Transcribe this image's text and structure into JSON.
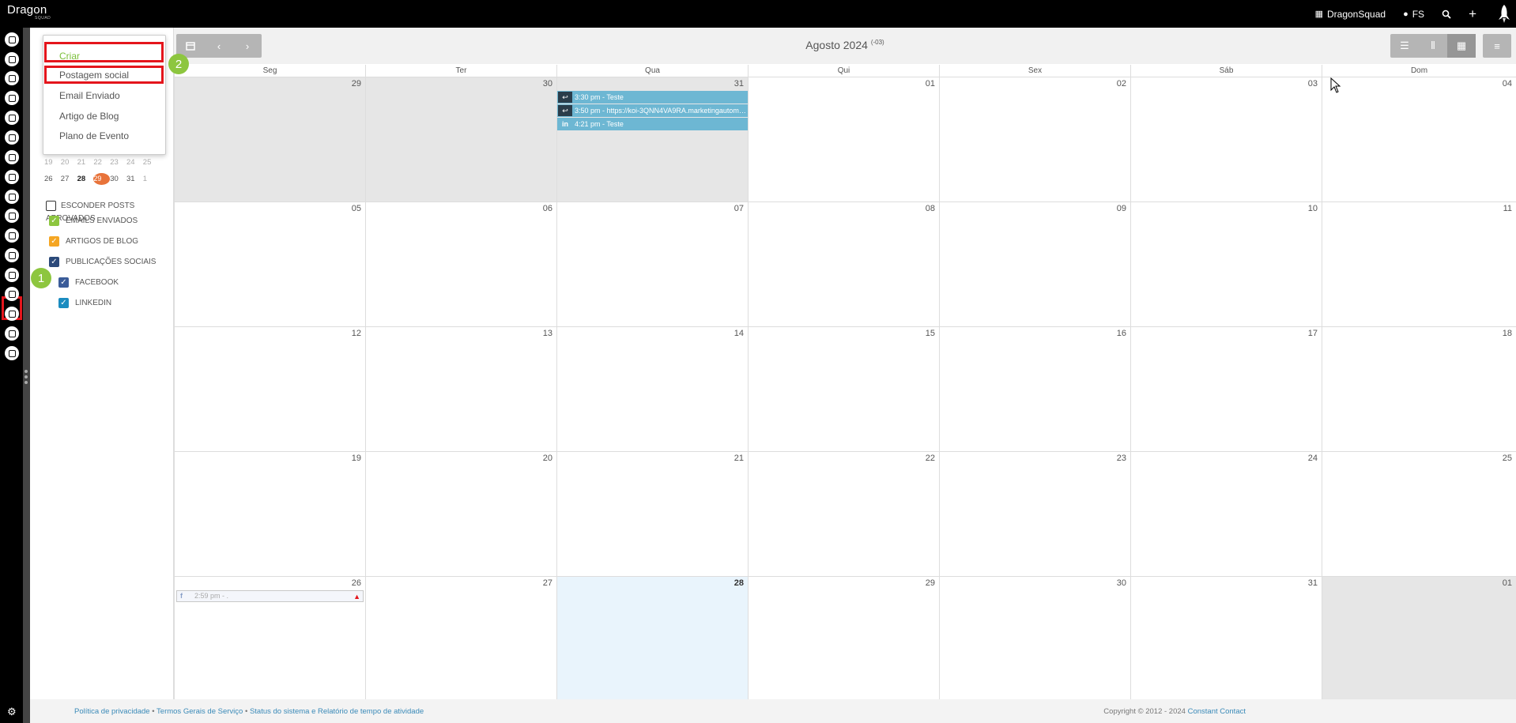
{
  "topbar": {
    "logo": "Dragon",
    "logo_sub": "SQUAD",
    "org": "DragonSquad",
    "user": "FS",
    "icons": [
      "building-icon",
      "user-icon",
      "search-icon",
      "plus-icon",
      "rocket-icon"
    ]
  },
  "rail": {
    "icons": [
      "contacts-icon",
      "email-icon",
      "clipboard-icon",
      "map-icon",
      "workflow-icon",
      "list-icon",
      "megaphone-icon",
      "badge-icon",
      "thumbs-up-icon",
      "social-icon",
      "calendar-icon",
      "handshake-icon",
      "analytics-icon",
      "support-icon",
      "user-add-icon",
      "bar-chart-icon",
      "plugin-icon"
    ],
    "active_index": 10
  },
  "dropdown": {
    "header": "Criar",
    "items": [
      "Postagem social",
      "Email Enviado",
      "Artigo de Blog",
      "Plano de Evento"
    ]
  },
  "badges": {
    "first": "1",
    "second": "2"
  },
  "mini_calendar": {
    "rows": [
      [
        "19",
        "20",
        "21",
        "22",
        "23",
        "24",
        "25"
      ],
      [
        "26",
        "27",
        "28",
        "29",
        "30",
        "31",
        "1"
      ]
    ],
    "today": "29",
    "bold": "28"
  },
  "filters": {
    "hide_posts": "ESCONDER POSTS APROVADOS",
    "emails": "EMAILS ENVIADOS",
    "blog": "ARTIGOS DE BLOG",
    "social": "PUBLICAÇÕES SOCIAIS",
    "facebook": "FACEBOOK",
    "linkedin": "LINKEDIN"
  },
  "calendar": {
    "month": "Agosto 2024",
    "tz": "(-03)",
    "dow": [
      "Seg",
      "Ter",
      "Qua",
      "Qui",
      "Sex",
      "Sáb",
      "Dom"
    ],
    "weeks": [
      [
        "29",
        "30",
        "31",
        "01",
        "02",
        "03",
        "04"
      ],
      [
        "05",
        "06",
        "07",
        "08",
        "09",
        "10",
        "11"
      ],
      [
        "12",
        "13",
        "14",
        "15",
        "16",
        "17",
        "18"
      ],
      [
        "19",
        "20",
        "21",
        "22",
        "23",
        "24",
        "25"
      ],
      [
        "26",
        "27",
        "28",
        "29",
        "30",
        "31",
        "01"
      ]
    ],
    "events": {
      "e1": "3:30 pm - Teste",
      "e2": "3:50 pm - https://koi-3QNN4VA9RA.marketingautomation...",
      "e3": "4:21 pm - Teste",
      "e4": "2:59 pm - ."
    }
  },
  "footer": {
    "privacy": "Política de privacidade",
    "terms": "Termos Gerais de Serviço",
    "status": "Status do sistema e Relatório de tempo de atividade",
    "copyright": "Copyright © 2012 - 2024",
    "brand": "Constant Contact"
  },
  "colors": {
    "accent_red": "#e4151c",
    "badge_green": "#8dc63f",
    "event_blue": "#6db7d3",
    "today_orange": "#e8733a"
  }
}
